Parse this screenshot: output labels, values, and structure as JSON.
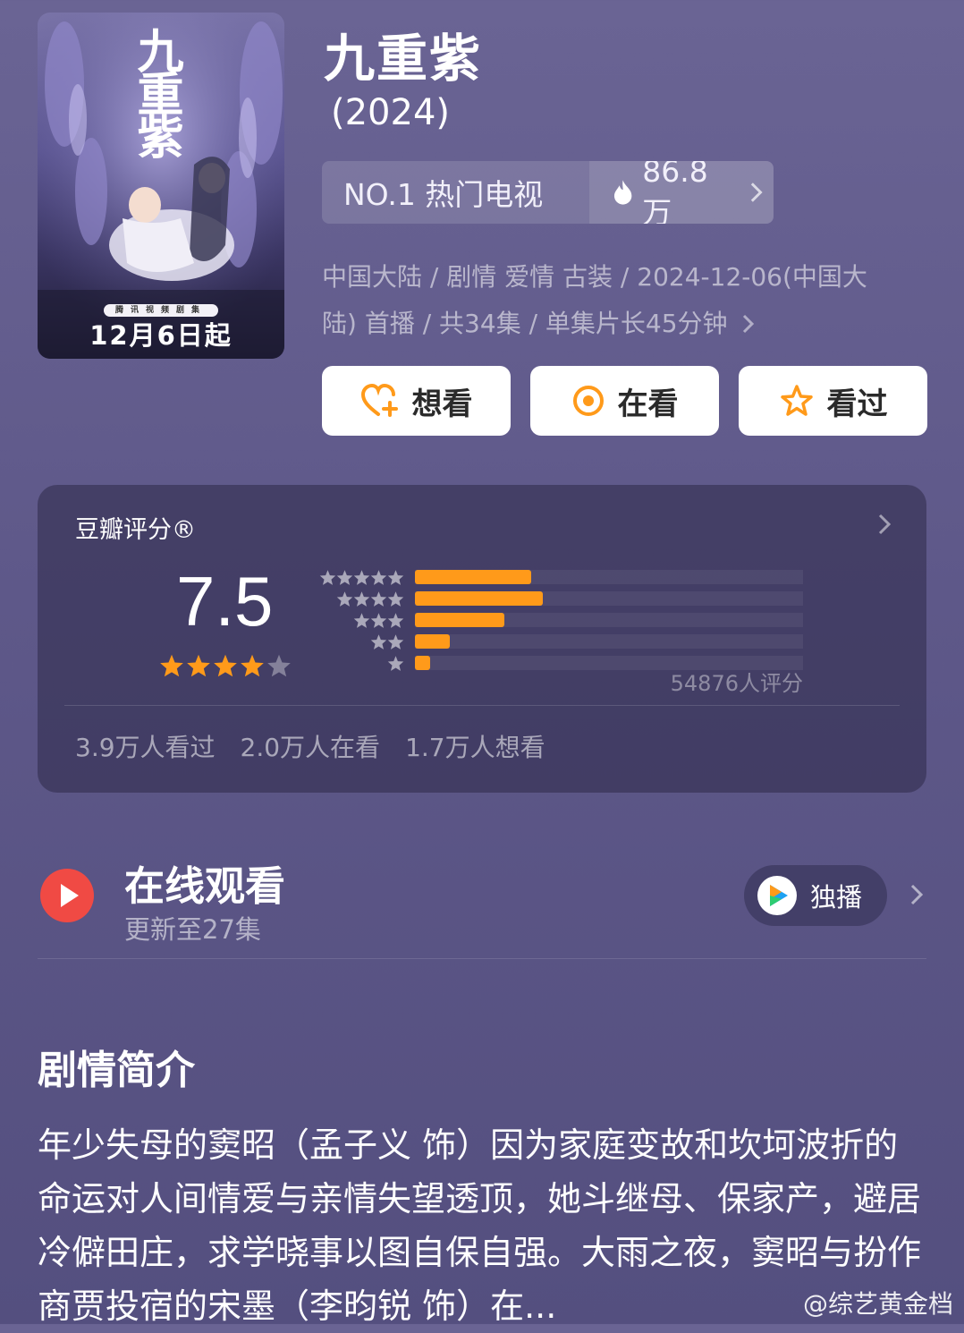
{
  "poster": {
    "title_text": "九重紫",
    "strip_text": "腾讯视频剧集",
    "date_text": "12月6日起"
  },
  "show": {
    "title": "九重紫",
    "year": "(2024)",
    "rank_label": "NO.1 热门电视",
    "heat_value": "86.8万",
    "meta_line1": "中国大陆 / 剧情 爱情 古装 / 2024-12-06(中国大",
    "meta_line2": "陆) 首播 / 共34集 / 单集片长45分钟"
  },
  "actions": {
    "want": "想看",
    "watching": "在看",
    "watched": "看过"
  },
  "rating": {
    "label": "豆瓣评分®",
    "score": "7.5",
    "stars_filled": 4,
    "distribution": [
      {
        "stars": 5,
        "fraction": 0.3
      },
      {
        "stars": 4,
        "fraction": 0.33
      },
      {
        "stars": 3,
        "fraction": 0.23
      },
      {
        "stars": 2,
        "fraction": 0.09
      },
      {
        "stars": 1,
        "fraction": 0.04
      }
    ],
    "count": "54876人评分",
    "watched": "3.9万人看过",
    "watching": "2.0万人在看",
    "want": "1.7万人想看"
  },
  "watch": {
    "title": "在线观看",
    "subtitle": "更新至27集",
    "exclusive": "独播"
  },
  "synopsis": {
    "title": "剧情简介",
    "text": "年少失母的窦昭（孟子义 饰）因为家庭变故和坎坷波折的命运对人间情爱与亲情失望透顶，她斗继母、保家产，避居冷僻田庄，求学晓事以图自保自强。大雨之夜，窦昭与扮作商贾投宿的宋墨（李昀锐 饰）在..."
  },
  "watermark": "@综艺黄金档",
  "colors": {
    "accent_orange": "#ff9a1a",
    "play_red": "#f04a44",
    "star_orange": "#ff9a1a"
  }
}
